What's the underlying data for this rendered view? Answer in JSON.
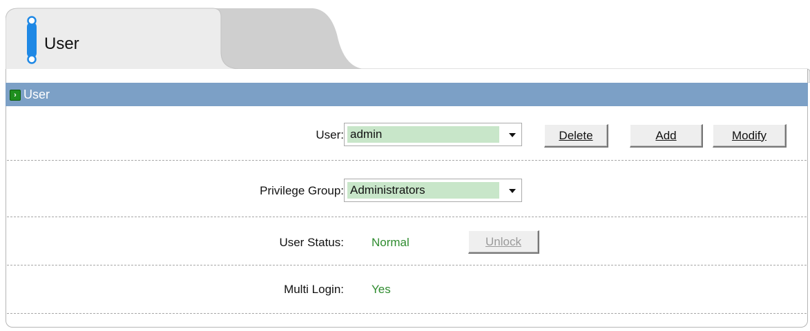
{
  "tab": {
    "title": "User"
  },
  "section": {
    "title": "User"
  },
  "form": {
    "user": {
      "label": "User:",
      "value": "admin"
    },
    "buttons": {
      "delete": "Delete",
      "add": "Add",
      "modify": "Modify"
    },
    "privilege_group": {
      "label": "Privilege Group:",
      "value": "Administrators"
    },
    "user_status": {
      "label": "User Status:",
      "value": "Normal",
      "unlock": "Unlock"
    },
    "multi_login": {
      "label": "Multi Login:",
      "value": "Yes"
    }
  },
  "colors": {
    "section_bar": "#7ca0c6",
    "select_fill": "#c8e6c9",
    "value_text": "#2e8b2e"
  }
}
